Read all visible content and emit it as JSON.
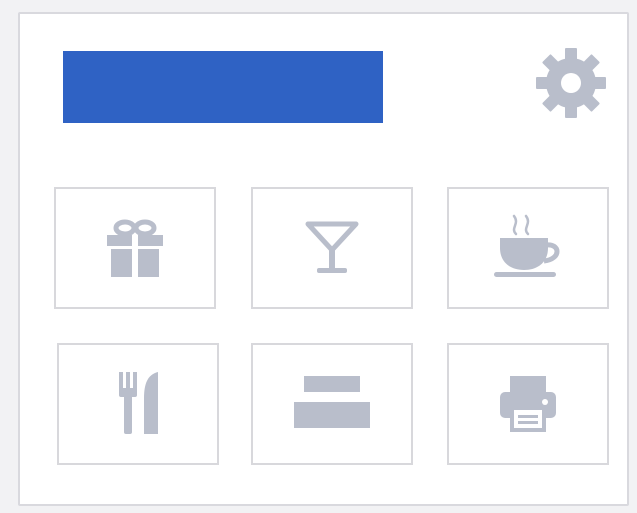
{
  "header": {
    "title_bar_color": "#2f62c4",
    "settings_icon": "gear-icon"
  },
  "colors": {
    "icon": "#b9becb",
    "tile_border": "#d8d8dc",
    "panel_border": "#d9d9de",
    "background": "#f2f2f4"
  },
  "tiles": [
    {
      "icon": "gift-icon"
    },
    {
      "icon": "cocktail-icon"
    },
    {
      "icon": "coffee-cup-icon"
    },
    {
      "icon": "cutlery-icon"
    },
    {
      "icon": "bed-icon"
    },
    {
      "icon": "printer-icon"
    }
  ]
}
